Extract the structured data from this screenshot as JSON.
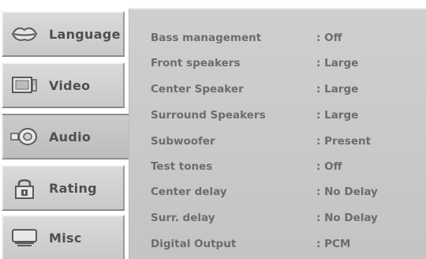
{
  "sidebar": {
    "tabs": [
      {
        "label": "Language",
        "icon": "lips-icon"
      },
      {
        "label": "Video",
        "icon": "monitor-icon"
      },
      {
        "label": "Audio",
        "icon": "speaker-icon"
      },
      {
        "label": "Rating",
        "icon": "lock-icon"
      },
      {
        "label": "Misc",
        "icon": "tv-display-icon"
      }
    ],
    "active_tab": "Audio"
  },
  "settings": [
    {
      "label": "Bass management",
      "value": ": Off"
    },
    {
      "label": "Front speakers",
      "value": ": Large"
    },
    {
      "label": "Center Speaker",
      "value": ": Large"
    },
    {
      "label": "Surround Speakers",
      "value": ": Large"
    },
    {
      "label": "Subwoofer",
      "value": ": Present"
    },
    {
      "label": "Test tones",
      "value": ": Off"
    },
    {
      "label": "Center delay",
      "value": ": No Delay"
    },
    {
      "label": "Surr. delay",
      "value": ": No Delay"
    },
    {
      "label": "Digital Output",
      "value": ": PCM"
    }
  ],
  "colors": {
    "panel_bg": "#cacaca",
    "tab_bg": "#d2d2d2",
    "text": "#6c6c6c",
    "tab_text": "#4f4f4f"
  }
}
